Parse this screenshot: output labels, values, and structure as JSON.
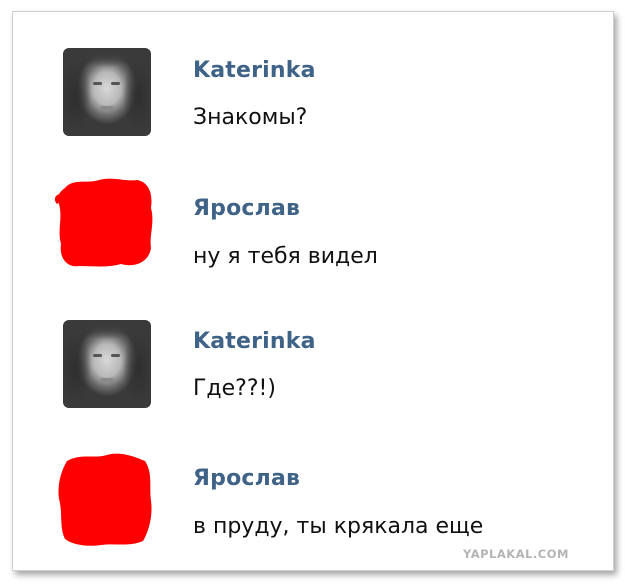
{
  "messages": [
    {
      "author": "Katerinka",
      "text": "Знакомы?",
      "avatar": "user-photo"
    },
    {
      "author": "Ярослав",
      "text": "ну я тебя видел",
      "avatar": "redacted-red"
    },
    {
      "author": "Katerinka",
      "text": "Где??!)",
      "avatar": "user-photo"
    },
    {
      "author": "Ярослав",
      "text": "в пруду, ты крякала еще",
      "avatar": "redacted-red"
    }
  ],
  "colors": {
    "author_name": "#3f6287",
    "message_text": "#111111",
    "redaction": "#ff0000",
    "watermark": "#b4b4b4"
  },
  "watermark": "YAPLAKAL.COM"
}
